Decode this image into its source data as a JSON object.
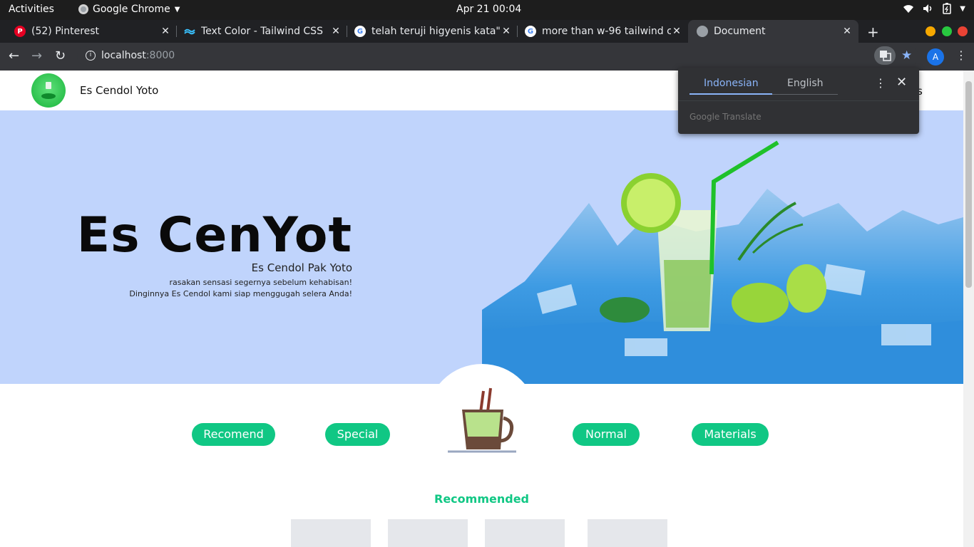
{
  "os_bar": {
    "activities": "Activities",
    "app_name": "Google Chrome",
    "clock": "Apr 21  00:04"
  },
  "tabs": [
    {
      "title": "(52) Pinterest",
      "icon": "pinterest-icon"
    },
    {
      "title": "Text Color - Tailwind CSS",
      "icon": "tailwind-icon"
    },
    {
      "title": "telah teruji higyenis kata\"",
      "icon": "google-icon"
    },
    {
      "title": "more than w-96 tailwind c",
      "icon": "google-icon"
    },
    {
      "title": "Document",
      "icon": "globe-icon"
    }
  ],
  "address": {
    "host": "localhost",
    "port": ":8000"
  },
  "profile_initial": "A",
  "site": {
    "brand": "Es Cendol Yoto",
    "nav_partial": "s"
  },
  "hero": {
    "title": "Es CenYot",
    "subtitle": "Es Cendol Pak Yoto",
    "line1": "rasakan sensasi segernya sebelum kehabisan!",
    "line2": "Dinginnya Es Cendol kami siap menggugah selera Anda!"
  },
  "menu": {
    "recomend": "Recomend",
    "special": "Special",
    "normal": "Normal",
    "materials": "Materials"
  },
  "recommended_heading": "Recommended",
  "translate_popup": {
    "lang_from": "Indonesian",
    "lang_to": "English",
    "credit": "Google Translate"
  },
  "colors": {
    "accent": "#10c784",
    "hero_bg": "#c0d4fc",
    "chrome_dark": "#202124"
  }
}
